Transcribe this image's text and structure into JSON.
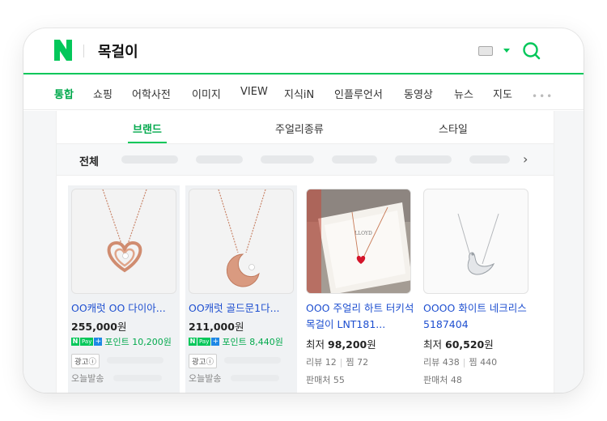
{
  "search": {
    "query": "목걸이"
  },
  "colors": {
    "brand_green": "#03c75a",
    "link_blue": "#1e4fd0"
  },
  "tabs": [
    "통합",
    "쇼핑",
    "어학사전",
    "이미지",
    "VIEW",
    "지식iN",
    "인플루언서",
    "동영상",
    "뉴스",
    "지도"
  ],
  "more_label": "•••",
  "subtabs": [
    "브랜드",
    "주얼리종류",
    "스타일"
  ],
  "filter": {
    "all_label": "전체",
    "arrow": "›"
  },
  "products": [
    {
      "title": "OO캐럿 OO 다이아...",
      "price": "255,000",
      "won": "원",
      "point": "포인트 10,200원",
      "ad": "광고ⓘ",
      "shipping": "오늘발송",
      "image": "rose-gold-heart-necklace"
    },
    {
      "title": "OO캐럿 골드문1다...",
      "price": "211,000",
      "won": "원",
      "point": "포인트 8,440원",
      "ad": "광고ⓘ",
      "shipping": "오늘발송",
      "image": "rose-gold-moon-necklace"
    },
    {
      "title": "OOO 주얼리 하트 터키석 목걸이 LNT181...",
      "price_prefix": "최저",
      "price": "98,200",
      "won": "원",
      "review_label": "리뷰 12",
      "zzim_label": "찜 72",
      "seller_label": "판매처 55",
      "image": "red-heart-necklace-box"
    },
    {
      "title": "OOOO 화이트 네크리스 5187404",
      "price_prefix": "최저",
      "price": "60,520",
      "won": "원",
      "review_label": "리뷰 438",
      "zzim_label": "찜 440",
      "seller_label": "판매처 48",
      "image": "silver-swan-necklace"
    }
  ],
  "npay_labels": {
    "n": "N",
    "pay": "Pay",
    "plus": "+"
  }
}
